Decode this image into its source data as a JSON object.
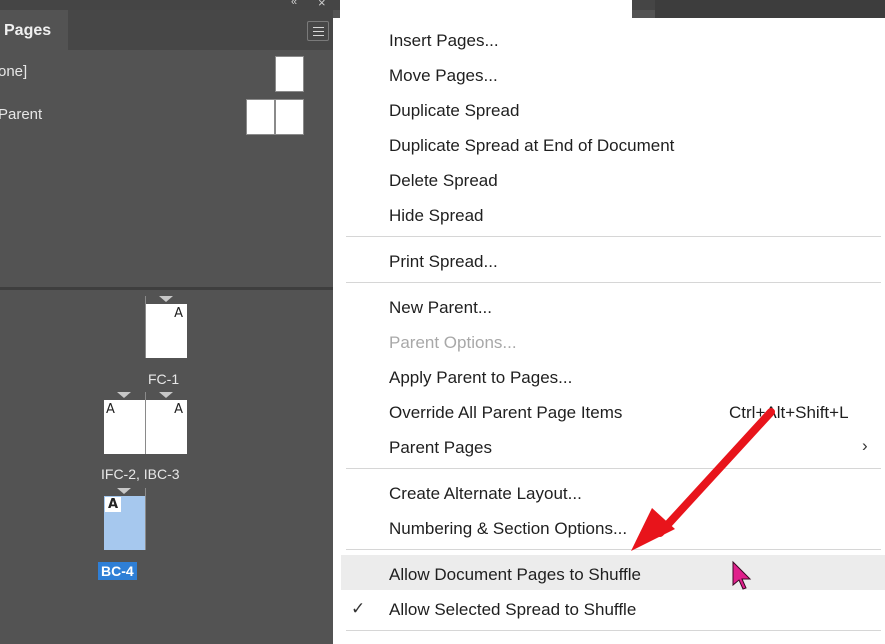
{
  "panel": {
    "tab_label": "Pages",
    "parents": [
      {
        "label": "one]"
      },
      {
        "label": "Parent"
      }
    ],
    "pages": [
      {
        "label": "FC-1",
        "letters": [
          "A"
        ]
      },
      {
        "label": "IFC-2, IBC-3",
        "letters": [
          "A",
          "A"
        ]
      },
      {
        "label": "BC-4",
        "letters": [
          "A"
        ],
        "selected": true
      }
    ]
  },
  "menu": {
    "items": [
      {
        "label": "Insert Pages..."
      },
      {
        "label": "Move Pages..."
      },
      {
        "label": "Duplicate Spread"
      },
      {
        "label": "Duplicate Spread at End of Document"
      },
      {
        "label": "Delete Spread"
      },
      {
        "label": "Hide Spread"
      },
      {
        "label": "Print Spread..."
      },
      {
        "label": "New Parent..."
      },
      {
        "label": "Parent Options...",
        "disabled": true
      },
      {
        "label": "Apply Parent to Pages..."
      },
      {
        "label": "Override All Parent Page Items",
        "shortcut": "Ctrl+Alt+Shift+L"
      },
      {
        "label": "Parent Pages",
        "submenu": true
      },
      {
        "label": "Create Alternate Layout..."
      },
      {
        "label": "Numbering & Section Options..."
      },
      {
        "label": "Allow Document Pages to Shuffle",
        "highlighted": true
      },
      {
        "label": "Allow Selected Spread to Shuffle",
        "checked": true
      }
    ]
  },
  "colors": {
    "selection": "#2f7fd6",
    "annotation_arrow": "#e8141b",
    "cursor": "#e0208c"
  }
}
